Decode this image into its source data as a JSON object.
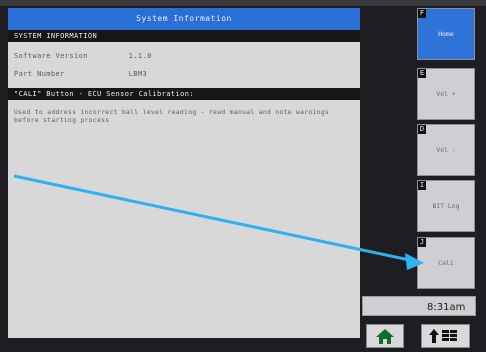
{
  "window": {
    "title": "System Information"
  },
  "sections": {
    "system_information": "SYSTEM INFORMATION",
    "cali_header": "\"CALI\" Button - ECU Sensor Calibration:"
  },
  "info_rows": [
    {
      "label": "Software Version",
      "value": "1.1.0"
    },
    {
      "label": "Part Number",
      "value": "LBM3"
    }
  ],
  "description": "Used to address incorrect ball level reading - read manual and note warnings before starting process",
  "side_buttons": [
    {
      "number": "F",
      "label": "Home"
    },
    {
      "number": "E",
      "label": "Vol +"
    },
    {
      "number": "D",
      "label": "Vol -"
    },
    {
      "number": "I",
      "label": "BIT Log"
    },
    {
      "number": "J",
      "label": "Cali"
    }
  ],
  "clock": "8:31am",
  "icons": {
    "home": "home-icon",
    "scroll": "up-arrow-menu-icon"
  },
  "colors": {
    "title_blue": "#2a6fd6",
    "arrow_blue": "#2db2ef",
    "home_green": "#136b2f"
  }
}
